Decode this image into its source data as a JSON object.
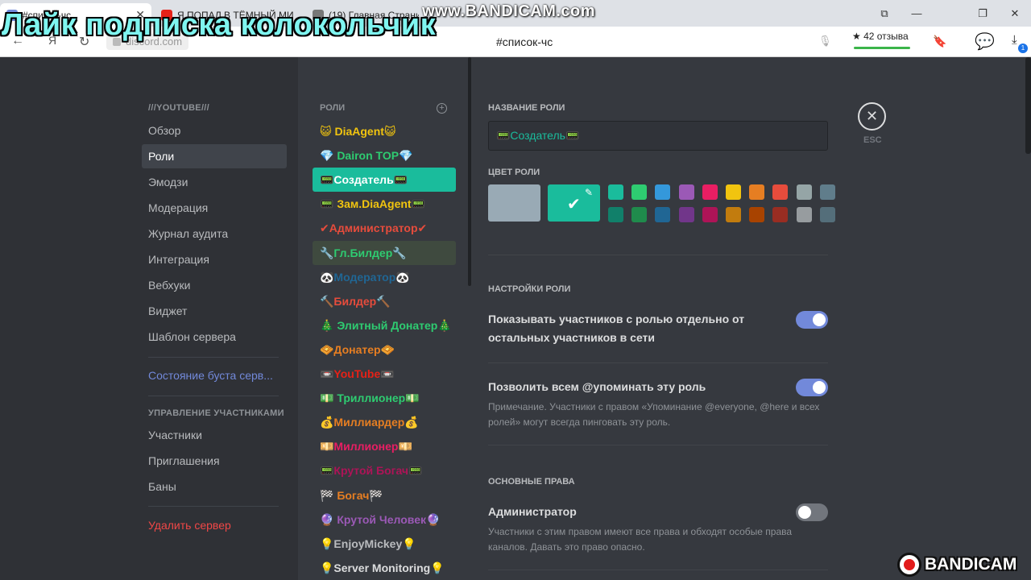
{
  "browser": {
    "tabs": [
      {
        "title": "#список-чс",
        "favicon_color": "#7289da"
      },
      {
        "title": "Я ПОПАЛ В ТЁМНЫЙ МИ",
        "favicon_color": "#e62117"
      },
      {
        "title": "(19) Главная Страни",
        "favicon_color": "#777777"
      }
    ],
    "url_text": "discord.com",
    "page_title": "#список-чс",
    "rating": "★ 42 отзыва",
    "downloads_count": "1",
    "yandex_label": "Я"
  },
  "overlays": {
    "top_watermark": "www.BANDICAM.com",
    "caption": "Лайк подписка колокольчик",
    "bottom_watermark": "BANDICAM"
  },
  "sidebar": {
    "server_header": "///YOUTUBE///",
    "items": [
      {
        "label": "Обзор"
      },
      {
        "label": "Роли"
      },
      {
        "label": "Эмодзи"
      },
      {
        "label": "Модерация"
      },
      {
        "label": "Журнал аудита"
      },
      {
        "label": "Интеграция"
      },
      {
        "label": "Вебхуки"
      },
      {
        "label": "Виджет"
      },
      {
        "label": "Шаблон сервера"
      }
    ],
    "boost_status": "Состояние буста серв...",
    "members_header": "УПРАВЛЕНИЕ УЧАСТНИКАМИ",
    "member_items": [
      {
        "label": "Участники"
      },
      {
        "label": "Приглашения"
      },
      {
        "label": "Баны"
      }
    ],
    "delete_server": "Удалить сервер",
    "selected": "Роли"
  },
  "roles": {
    "header": "РОЛИ",
    "list": [
      {
        "name": "😺 DiaAgent😺",
        "color": "#f1c40f"
      },
      {
        "name": "💎 Dairon TOP💎",
        "color": "#2ecc71"
      },
      {
        "name": "📟Создатель📟",
        "color": "#ffffff",
        "selected": true
      },
      {
        "name": "📟 Зам.DiaAgent📟",
        "color": "#f1c40f"
      },
      {
        "name": "✔Администратор✔",
        "color": "#e74c3c"
      },
      {
        "name": "🔧Гл.Билдер🔧",
        "color": "#2ecc71",
        "hover": true
      },
      {
        "name": "🐼Модератор🐼",
        "color": "#206694"
      },
      {
        "name": "🔨Билдер🔨",
        "color": "#e74c3c"
      },
      {
        "name": "🎄 Элитный Донатер🎄",
        "color": "#2ecc71"
      },
      {
        "name": "🧇Донатер🧇",
        "color": "#e67e22"
      },
      {
        "name": "📼YouTube📼",
        "color": "#e62117"
      },
      {
        "name": "💵 Триллионер💵",
        "color": "#2ecc71"
      },
      {
        "name": "💰Миллиардер💰",
        "color": "#e67e22"
      },
      {
        "name": "💴Миллионер💴",
        "color": "#e91e63"
      },
      {
        "name": "📟Крутой Богач📟",
        "color": "#ad1457"
      },
      {
        "name": "🏁 Богач🏁",
        "color": "#e67e22"
      },
      {
        "name": "🔮 Крутой Человек🔮",
        "color": "#9b59b6"
      },
      {
        "name": "💡EnjoyMickey💡",
        "color": "#b9bbbe"
      },
      {
        "name": "💡Server Monitoring💡",
        "color": "#dcddde"
      }
    ]
  },
  "role_editor": {
    "name_label": "НАЗВАНИЕ РОЛИ",
    "name_value": "📟Создатель📟",
    "color_label": "ЦВЕТ РОЛИ",
    "default_color": "#99aab5",
    "custom_color": "#1abc9c",
    "palette_top": [
      "#1abc9c",
      "#2ecc71",
      "#3498db",
      "#9b59b6",
      "#e91e63",
      "#f1c40f",
      "#e67e22",
      "#e74c3c",
      "#95a5a6",
      "#607d8b"
    ],
    "palette_bottom": [
      "#11806a",
      "#1f8b4c",
      "#206694",
      "#71368a",
      "#ad1457",
      "#c27c0e",
      "#a84300",
      "#992d22",
      "#979c9f",
      "#546e7a"
    ],
    "settings_header": "НАСТРОЙКИ РОЛИ",
    "hoist_title": "Показывать участников с ролью отдельно от остальных участников в сети",
    "hoist_enabled": true,
    "mention_title": "Позволить всем @упоминать эту роль",
    "mention_note": "Примечание. Участники с правом «Упоминание @everyone, @here и всех ролей» могут всегда пинговать эту роль.",
    "mention_enabled": true,
    "perms_header": "ОСНОВНЫЕ ПРАВА",
    "admin_title": "Администратор",
    "admin_note": "Участники с этим правом имеют все права и обходят особые права каналов. Давать это право опасно.",
    "admin_enabled": false,
    "esc_label": "ESC"
  }
}
